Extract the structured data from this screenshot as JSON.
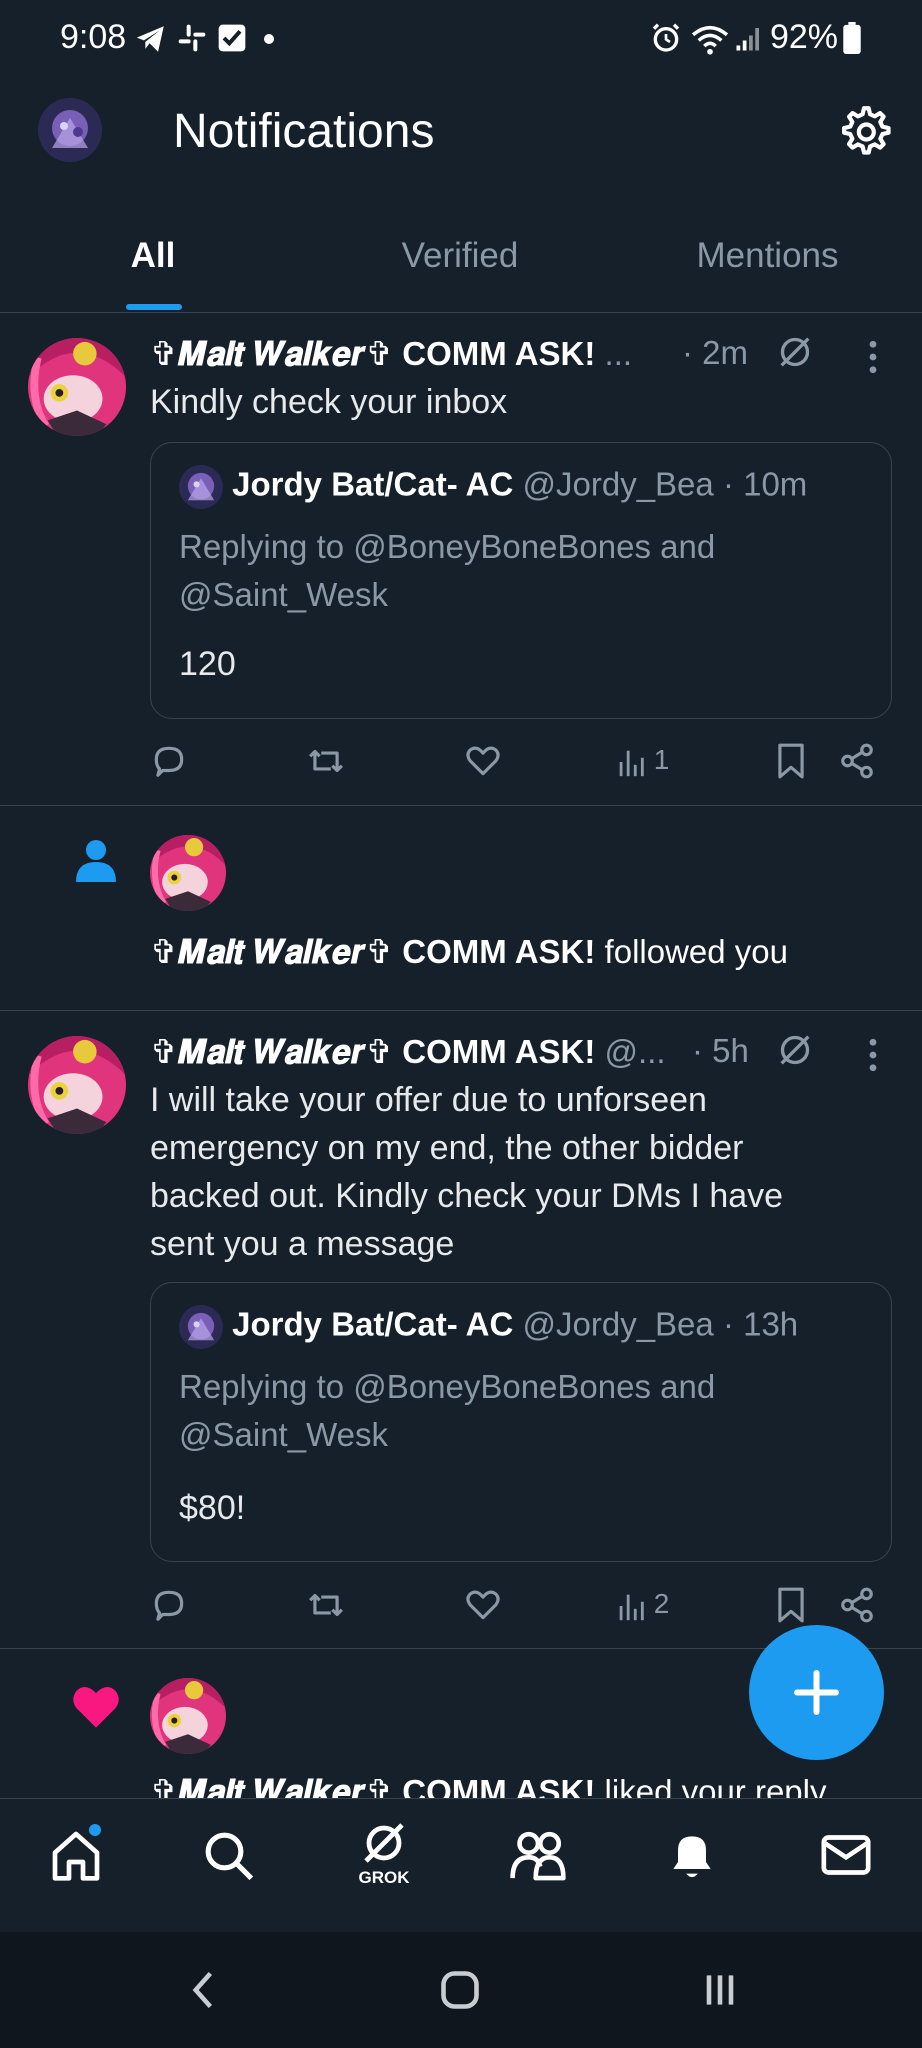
{
  "status_bar": {
    "time": "9:08",
    "battery": "92%",
    "icons": [
      "telegram-icon",
      "slack-icon",
      "checkbox-icon",
      "dot-icon",
      "alarm-icon",
      "wifi-icon",
      "signal-icon",
      "battery-icon"
    ]
  },
  "header": {
    "title": "Notifications"
  },
  "tabs": [
    {
      "label": "All",
      "active": true
    },
    {
      "label": "Verified",
      "active": false
    },
    {
      "label": "Mentions",
      "active": false
    }
  ],
  "notifications": [
    {
      "type": "reply",
      "display_name_script": "✞𝑴𝒂𝒍𝒕 𝑾𝒂𝒍𝒌𝒆𝒓✞",
      "display_name_rest": "COMM ASK!",
      "handle_trunc": "...",
      "time": "· 2m",
      "text": "Kindly check your inbox",
      "quote": {
        "name": "Jordy Bat/Cat- AC",
        "handle": "@Jordy_Bea",
        "time": "· 10m",
        "replying": "Replying to @BoneyBoneBones and @Saint_Wesk",
        "body": "120"
      },
      "views": "1"
    },
    {
      "type": "follow",
      "display_name_script": "✞𝑴𝒂𝒍𝒕 𝑾𝒂𝒍𝒌𝒆𝒓✞",
      "display_name_rest": "COMM ASK!",
      "action_text": "followed you"
    },
    {
      "type": "reply",
      "display_name_script": "✞𝑴𝒂𝒍𝒕 𝑾𝒂𝒍𝒌𝒆𝒓✞",
      "display_name_rest": "COMM ASK!",
      "handle_trunc": "@...",
      "time": "· 5h",
      "text": "I will take your offer due to unforseen emergency on my end, the other bidder backed out. Kindly check your DMs I have sent you a message",
      "quote": {
        "name": "Jordy Bat/Cat- AC",
        "handle": "@Jordy_Bea",
        "time": "· 13h",
        "replying": "Replying to @BoneyBoneBones and @Saint_Wesk",
        "body": "$80!"
      },
      "views": "2"
    },
    {
      "type": "like",
      "display_name_script": "✞𝑴𝒂𝒍𝒕 𝑾𝒂𝒍𝒌𝒆𝒓✞",
      "display_name_rest": "COMM ASK!",
      "action_text": "liked your reply"
    }
  ],
  "bottom_nav": {
    "grok_label": "GROK"
  },
  "colors": {
    "background": "#15202b",
    "accent": "#1d9bf0",
    "muted": "#8b98a5",
    "like": "#f91880"
  }
}
